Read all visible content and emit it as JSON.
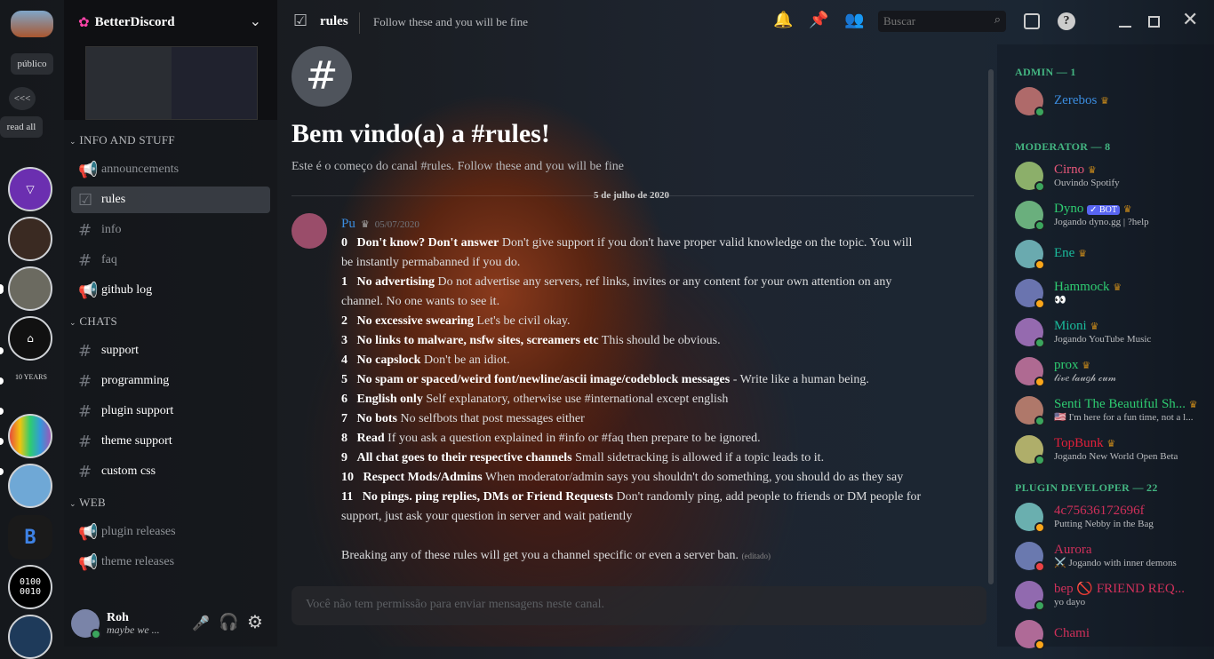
{
  "rail": {
    "public_label": "público",
    "collapse_label": "<<<",
    "read_all_label": "read all",
    "ten_years_label": "10 YEARS",
    "binary_label": "0100\n0010"
  },
  "server": {
    "name": "BetterDiscord"
  },
  "categories": [
    {
      "name": "INFO AND STUFF",
      "channels": [
        {
          "name": "announcements",
          "icon": "megaphone"
        },
        {
          "name": "rules",
          "icon": "checkbox",
          "selected": true
        },
        {
          "name": "info",
          "icon": "hash"
        },
        {
          "name": "faq",
          "icon": "hash"
        },
        {
          "name": "github log",
          "icon": "megaphone",
          "unread": true
        }
      ]
    },
    {
      "name": "CHATS",
      "channels": [
        {
          "name": "support",
          "icon": "hash",
          "unread": true
        },
        {
          "name": "programming",
          "icon": "hash",
          "unread": true
        },
        {
          "name": "plugin support",
          "icon": "hash",
          "unread": true
        },
        {
          "name": "theme support",
          "icon": "hash",
          "unread": true
        },
        {
          "name": "custom css",
          "icon": "hash",
          "unread": true
        }
      ]
    },
    {
      "name": "WEB",
      "channels": [
        {
          "name": "plugin releases",
          "icon": "megaphone"
        },
        {
          "name": "theme releases",
          "icon": "megaphone"
        }
      ]
    }
  ],
  "user": {
    "name": "Roh",
    "status": "maybe we ..."
  },
  "header": {
    "channel": "rules",
    "topic": "Follow these and you will be fine",
    "search_placeholder": "Buscar"
  },
  "welcome": {
    "title": "Bem vindo(a) a #rules!",
    "subtitle": "Este é o começo do canal #rules. Follow these and you will be fine",
    "divider_date": "5 de julho de 2020"
  },
  "message": {
    "author": "Pu",
    "timestamp": "05/07/2020",
    "edited": "(editado)",
    "rules": [
      {
        "num": "0",
        "title": "Don't know? Don't answer",
        "text": "Don't give support if you don't have proper valid knowledge on the topic. You will",
        "cont": "be instantly permabanned if you do."
      },
      {
        "num": "1",
        "title": "No advertising",
        "text": "Do not advertise any servers, ref links, invites or any content for your own attention on any",
        "cont": "channel. No one wants to see it."
      },
      {
        "num": "2",
        "title": "No excessive swearing",
        "text": "Let's be civil okay."
      },
      {
        "num": "3",
        "title": "No links to malware, nsfw sites, screamers etc",
        "text": "This should be obvious."
      },
      {
        "num": "4",
        "title": "No capslock",
        "text": "Don't be an idiot."
      },
      {
        "num": "5",
        "title": "No spam or spaced/weird font/newline/ascii image/codeblock messages",
        "text": "- Write like a human being."
      },
      {
        "num": "6",
        "title": "English only",
        "text": "Self explanatory, otherwise use #international except english"
      },
      {
        "num": "7",
        "title": "No bots",
        "text": "No selfbots that post messages either"
      },
      {
        "num": "8",
        "title": "Read",
        "text": "If you ask a question explained in #info or #faq then prepare to be ignored."
      },
      {
        "num": "9",
        "title": "All chat goes to their respective channels",
        "text": "Small sidetracking is allowed if a topic leads to it."
      },
      {
        "num": "10",
        "title": "Respect Mods/Admins",
        "text": "When moderator/admin says you shouldn't do something, you should do as they say"
      },
      {
        "num": "11",
        "title": "No pings. ping replies, DMs or Friend Requests",
        "text": "Don't randomly ping, add people to friends or DM people for",
        "cont": "support, just ask your question in server and wait patiently"
      }
    ],
    "footer": "Breaking any of these rules will get you a channel specific or even a server ban."
  },
  "composer": {
    "placeholder": "Você não tem permissão para enviar mensagens neste canal."
  },
  "members": {
    "roles": [
      {
        "name": "ADMIN — 1",
        "members": [
          {
            "name": "Zerebos",
            "color": "#3b8de0",
            "status": "mobile",
            "activity": ""
          }
        ]
      },
      {
        "name": "MODERATOR — 8",
        "members": [
          {
            "name": "Cirno",
            "color": "#e8577a",
            "status": "online",
            "activity": "Ouvindo Spotify"
          },
          {
            "name": "Dyno",
            "color": "#2ecc71",
            "status": "online",
            "activity": "Jogando dyno.gg | ?help",
            "bot": "✓ BOT"
          },
          {
            "name": "Ene",
            "color": "#1abc9c",
            "status": "idle",
            "activity": ""
          },
          {
            "name": "Hammock",
            "color": "#2ecc71",
            "status": "idle",
            "activity": "👀"
          },
          {
            "name": "Mioni",
            "color": "#1abc9c",
            "status": "online",
            "activity": "Jogando YouTube Music"
          },
          {
            "name": "prox",
            "color": "#2ecc71",
            "status": "idle",
            "activity": "𝓁𝒾𝓋𝑒 𝓁𝒶𝓊𝑔𝒽 𝒸𝓊𝓂"
          },
          {
            "name": "Senti The Beautiful Sh...",
            "color": "#2ecc71",
            "status": "online",
            "activity": "🇺🇸 I'm here for a fun time, not a l..."
          },
          {
            "name": "TopBunk",
            "color": "#e0203a",
            "status": "online",
            "activity": "Jogando New World Open Beta"
          }
        ]
      },
      {
        "name": "PLUGIN DEVELOPER — 22",
        "members": [
          {
            "name": "4c75636172696f",
            "color": "#d0305a",
            "status": "idle",
            "activity": "Putting Nebby in the Bag"
          },
          {
            "name": "Aurora",
            "color": "#d0305a",
            "status": "dnd",
            "activity": "⚔️ Jogando with inner demons"
          },
          {
            "name": "bep 🚫 FRIEND REQ...",
            "color": "#d0305a",
            "status": "online",
            "activity": "yo dayo"
          },
          {
            "name": "Chami",
            "color": "#d0305a",
            "status": "idle",
            "activity": ""
          }
        ]
      }
    ]
  },
  "colors": {
    "online": "#3ba55d",
    "idle": "#faa61a",
    "dnd": "#ed4245",
    "bot": "#5865f2",
    "role": "#43b581"
  }
}
